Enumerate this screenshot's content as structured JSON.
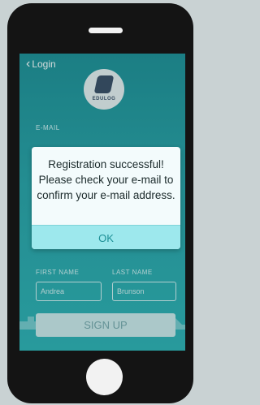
{
  "nav": {
    "back_label": "Login"
  },
  "logo": {
    "text": "EDULOG"
  },
  "form": {
    "email_label": "E-MAIL",
    "first_name_label": "FIRST NAME",
    "last_name_label": "LAST NAME",
    "first_name_value": "Andrea",
    "last_name_value": "Brunson",
    "signup_label": "SIGN UP"
  },
  "dialog": {
    "message": "Registration successful! Please check your e-mail to confirm your e-mail address.",
    "ok_label": "OK"
  },
  "colors": {
    "screen_teal": "#2aa1a6",
    "dialog_button": "#9de8ed",
    "phone_body": "#141414"
  }
}
